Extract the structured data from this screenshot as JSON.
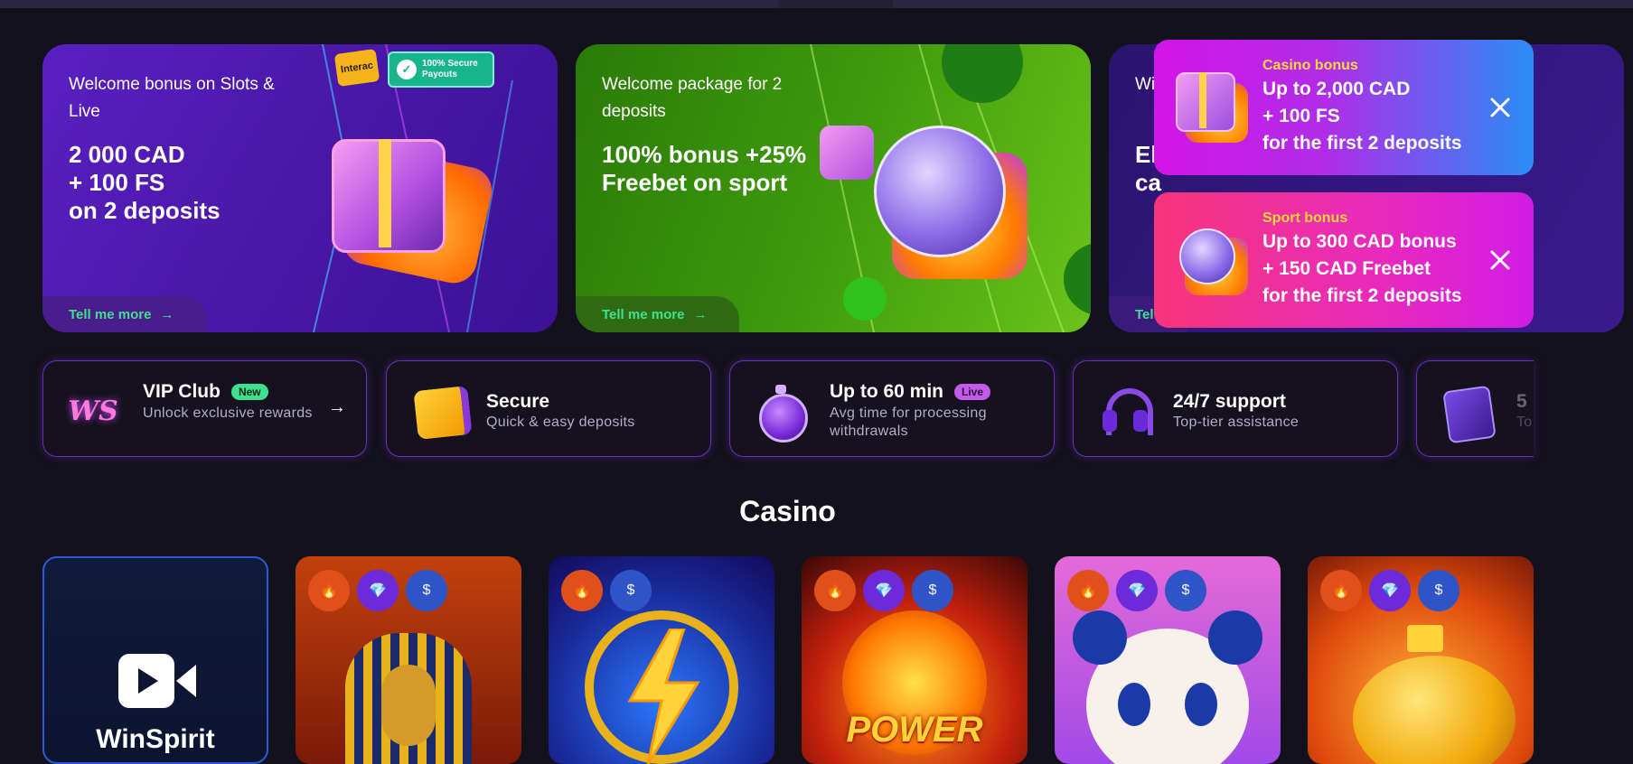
{
  "banners": [
    {
      "subtitle": "Welcome bonus on Slots & Live",
      "headline": [
        "2 000 CAD",
        "+ 100 FS",
        "on 2 deposits"
      ],
      "link": "Tell me more",
      "badges": [
        "Interac",
        "100% Secure Payouts"
      ]
    },
    {
      "subtitle": "Welcome package for 2 deposits",
      "headline": [
        "100% bonus +25%",
        "Freebet on sport"
      ],
      "link": "Tell me more"
    },
    {
      "subtitle": "Wi",
      "headline": [
        "El",
        "ca"
      ],
      "link": "Tel"
    }
  ],
  "toasts": [
    {
      "kicker": "Casino bonus",
      "lines": [
        "Up to 2,000 CAD",
        "+ 100 FS",
        "for the first 2 deposits"
      ],
      "icon": "gift-box-icon"
    },
    {
      "kicker": "Sport bonus",
      "lines": [
        "Up to 300 CAD bonus",
        "+ 150 CAD Freebet",
        "for the first 2 deposits"
      ],
      "icon": "soccer-ball-icon"
    }
  ],
  "features": [
    {
      "title": "VIP Club",
      "badge": "New",
      "subtitle": "Unlock exclusive rewards",
      "icon": "vip-logo-icon"
    },
    {
      "title": "Secure",
      "subtitle": "Quick & easy deposits",
      "icon": "interac-wallet-icon"
    },
    {
      "title": "Up to 60 min",
      "badge": "Live",
      "subtitle": "Avg time for processing withdrawals",
      "icon": "stopwatch-icon"
    },
    {
      "title": "24/7 support",
      "subtitle": "Top-tier assistance",
      "icon": "headset-icon"
    },
    {
      "title": "5",
      "subtitle": "To",
      "icon": "slots-box-icon"
    }
  ],
  "casino": {
    "title": "Casino",
    "tiles": [
      {
        "label": "WinSpirit",
        "chips": []
      },
      {
        "label": "POWER",
        "chips": [
          "fire",
          "diamond",
          "swap"
        ]
      },
      {
        "chips": [
          "fire",
          "swap"
        ]
      },
      {
        "chips": [
          "fire",
          "diamond",
          "swap"
        ]
      },
      {
        "chips": [
          "fire",
          "diamond",
          "swap"
        ]
      },
      {
        "chips": [
          "fire",
          "diamond",
          "swap"
        ]
      }
    ]
  },
  "colors": {
    "accent_green": "#3ee08f",
    "kicker_yellow": "#ffd93a",
    "background": "#13111c"
  }
}
